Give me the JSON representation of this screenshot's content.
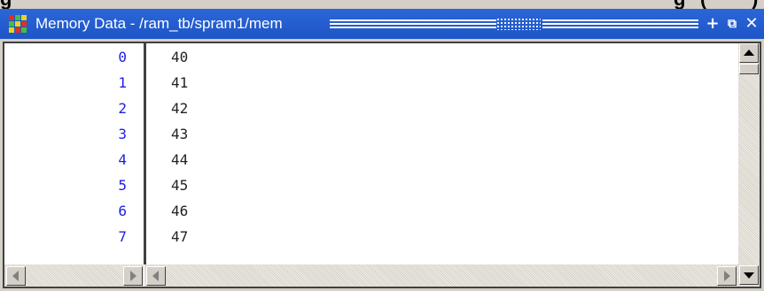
{
  "cropped_caption": "g         (        )",
  "window": {
    "title": "Memory Data - /ram_tb/spram1/mem",
    "buttons": {
      "dock": "+",
      "undock": "⧉",
      "close": "✕"
    }
  },
  "memory": {
    "rows": [
      {
        "address": "0",
        "value": "40"
      },
      {
        "address": "1",
        "value": "41"
      },
      {
        "address": "2",
        "value": "42"
      },
      {
        "address": "3",
        "value": "43"
      },
      {
        "address": "4",
        "value": "44"
      },
      {
        "address": "5",
        "value": "45"
      },
      {
        "address": "6",
        "value": "46"
      },
      {
        "address": "7",
        "value": "47"
      }
    ]
  },
  "colors": {
    "titlebar": "#245edb",
    "address_text": "#2020e0",
    "value_text": "#222222"
  }
}
